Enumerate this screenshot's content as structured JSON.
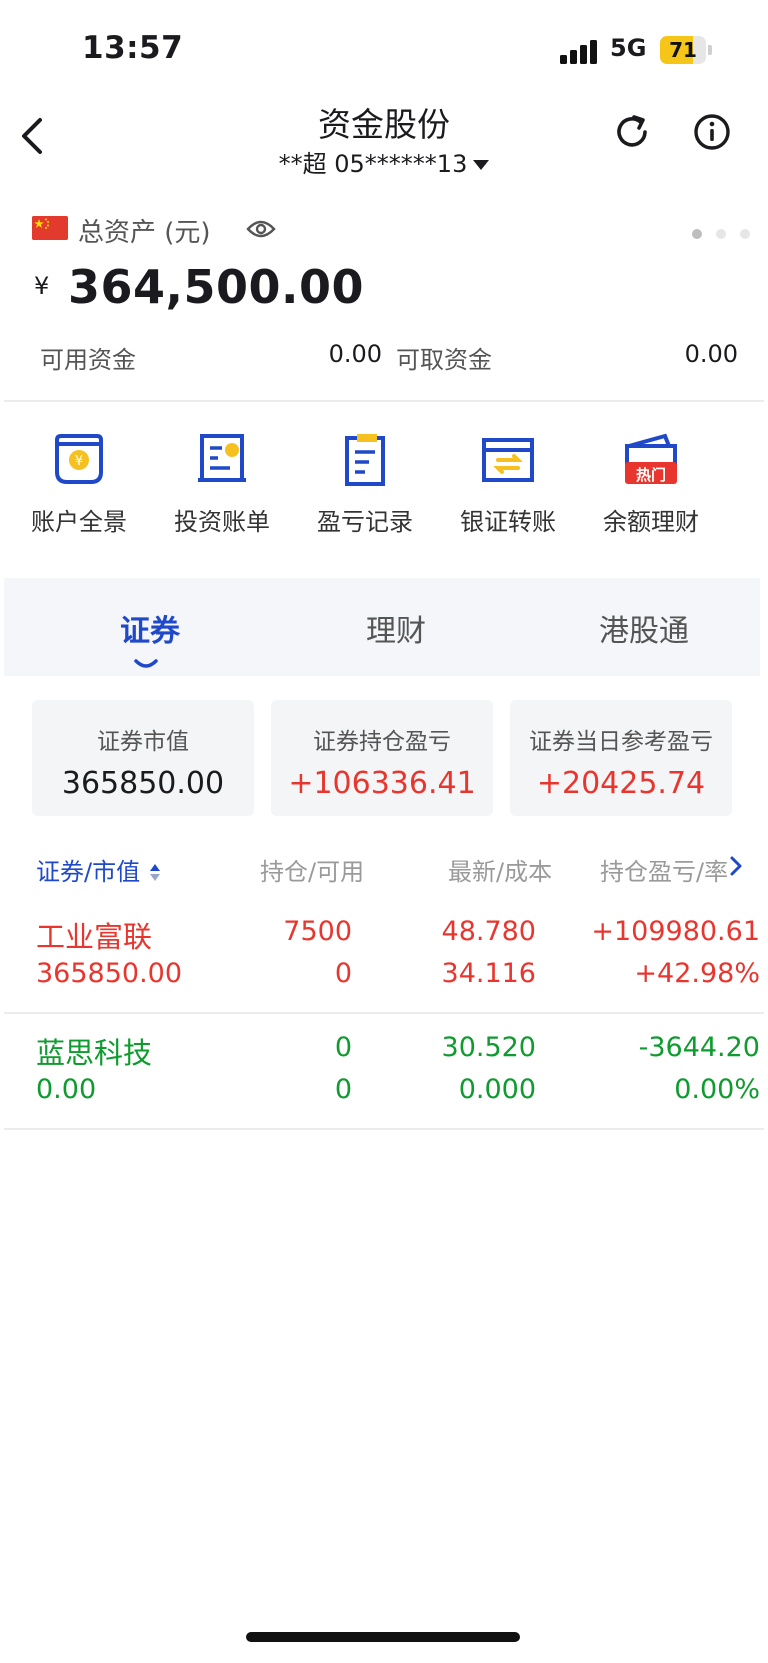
{
  "status_bar": {
    "time": "13:57",
    "network": "5G",
    "battery": "71"
  },
  "nav": {
    "title": "资金股份",
    "account": "**超 05******13"
  },
  "assets": {
    "label": "总资产 (元)",
    "currency_symbol": "¥",
    "total": "364,500.00",
    "available_label": "可用资金",
    "available_value": "0.00",
    "withdrawable_label": "可取资金",
    "withdrawable_value": "0.00"
  },
  "functions": [
    {
      "label": "账户全景",
      "icon": "account-overview-icon"
    },
    {
      "label": "投资账单",
      "icon": "investment-bill-icon"
    },
    {
      "label": "盈亏记录",
      "icon": "profit-record-icon"
    },
    {
      "label": "银证转账",
      "icon": "bank-transfer-icon"
    },
    {
      "label": "余额理财",
      "icon": "balance-wealth-icon",
      "badge": "热门"
    }
  ],
  "tabs": [
    "证券",
    "理财",
    "港股通"
  ],
  "summary": [
    {
      "title": "证券市值",
      "value": "365850.00"
    },
    {
      "title": "证券持仓盈亏",
      "value": "+106336.41"
    },
    {
      "title": "证券当日参考盈亏",
      "value": "+20425.74"
    }
  ],
  "table": {
    "headers": [
      "证券/市值",
      "持仓/可用",
      "最新/成本",
      "持仓盈亏/率"
    ],
    "rows": [
      {
        "name": "工业富联",
        "market_value": "365850.00",
        "position": "7500",
        "available": "0",
        "latest": "48.780",
        "cost": "34.116",
        "pnl": "+109980.61",
        "pnl_rate": "+42.98%"
      },
      {
        "name": "蓝思科技",
        "market_value": "0.00",
        "position": "0",
        "available": "0",
        "latest": "30.520",
        "cost": "0.000",
        "pnl": "-3644.20",
        "pnl_rate": "0.00%"
      }
    ]
  },
  "colors": {
    "accent": "#1f49c8",
    "gain": "#e8362f",
    "loss": "#0f9b2f",
    "icon_gold": "#f6c021",
    "hot": "#e8362f"
  }
}
